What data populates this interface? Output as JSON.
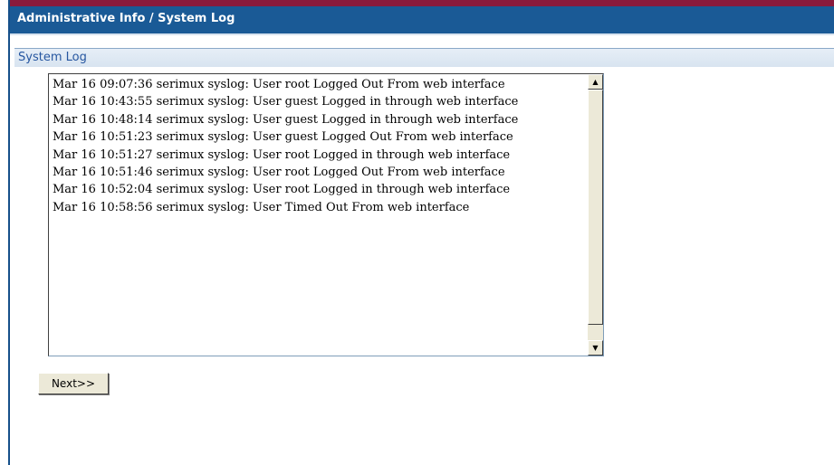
{
  "header": {
    "title": "Administrative Info / System Log"
  },
  "section": {
    "title": "System Log"
  },
  "log": {
    "lines": [
      "Mar 16 09:07:36 serimux syslog: User root Logged Out From web interface",
      "Mar 16 10:43:55 serimux syslog: User guest Logged in through web interface",
      "Mar 16 10:48:14 serimux syslog: User guest Logged in through web interface",
      "Mar 16 10:51:23 serimux syslog: User guest Logged Out From web interface",
      "Mar 16 10:51:27 serimux syslog: User root Logged in through web interface",
      "Mar 16 10:51:46 serimux syslog: User root Logged Out From web interface",
      "Mar 16 10:52:04 serimux syslog: User root Logged in through web interface",
      "Mar 16 10:58:56 serimux syslog: User  Timed Out From web interface"
    ]
  },
  "scrollbar": {
    "up_icon": "arrow-up-icon",
    "down_icon": "arrow-down-icon"
  },
  "buttons": {
    "next_label": "Next>>"
  },
  "colors": {
    "titlebar": "#1a5a96",
    "top_strip": "#8a1a3c",
    "section_text": "#2656a0"
  }
}
